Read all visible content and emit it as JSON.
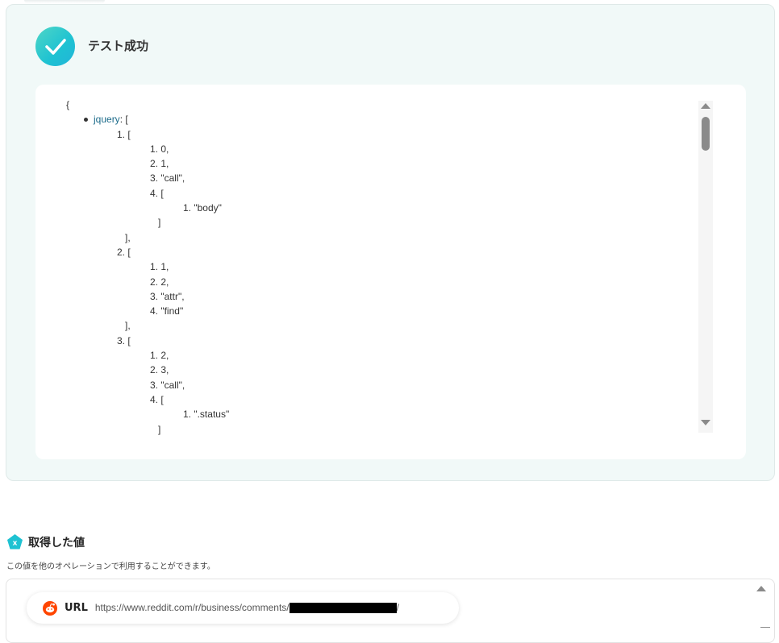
{
  "success": {
    "title": "テスト成功"
  },
  "json_lines": [
    {
      "indent": 0,
      "text": "{"
    },
    {
      "indent": 1,
      "bullet": true,
      "key": "jquery",
      "text": ": ["
    },
    {
      "indent": 2,
      "text": "1. ["
    },
    {
      "indent": 3,
      "text": "1. 0,"
    },
    {
      "indent": 3,
      "text": "2. 1,"
    },
    {
      "indent": 3,
      "text": "3. \"call\","
    },
    {
      "indent": 3,
      "text": "4. ["
    },
    {
      "indent": 4,
      "text": "1. \"body\""
    },
    {
      "indent": 3,
      "text": "   ]"
    },
    {
      "indent": 2,
      "text": "   ],"
    },
    {
      "indent": 2,
      "text": "2. ["
    },
    {
      "indent": 3,
      "text": "1. 1,"
    },
    {
      "indent": 3,
      "text": "2. 2,"
    },
    {
      "indent": 3,
      "text": "3. \"attr\","
    },
    {
      "indent": 3,
      "text": "4. \"find\""
    },
    {
      "indent": 2,
      "text": "   ],"
    },
    {
      "indent": 2,
      "text": "3. ["
    },
    {
      "indent": 3,
      "text": "1. 2,"
    },
    {
      "indent": 3,
      "text": "2. 3,"
    },
    {
      "indent": 3,
      "text": "3. \"call\","
    },
    {
      "indent": 3,
      "text": "4. ["
    },
    {
      "indent": 4,
      "text": "1. \".status\""
    },
    {
      "indent": 3,
      "text": "   ]"
    }
  ],
  "values": {
    "title": "取得した値",
    "description": "この値を他のオペレーションで利用することができます。",
    "items": [
      {
        "label": "URL",
        "value_prefix": "https://www.reddit.com/r/business/comments/",
        "value_suffix": "/"
      }
    ]
  },
  "colors": {
    "accent_teal": "#1ec2d2",
    "json_key": "#1c6b8a",
    "reddit_orange": "#ff4500"
  }
}
